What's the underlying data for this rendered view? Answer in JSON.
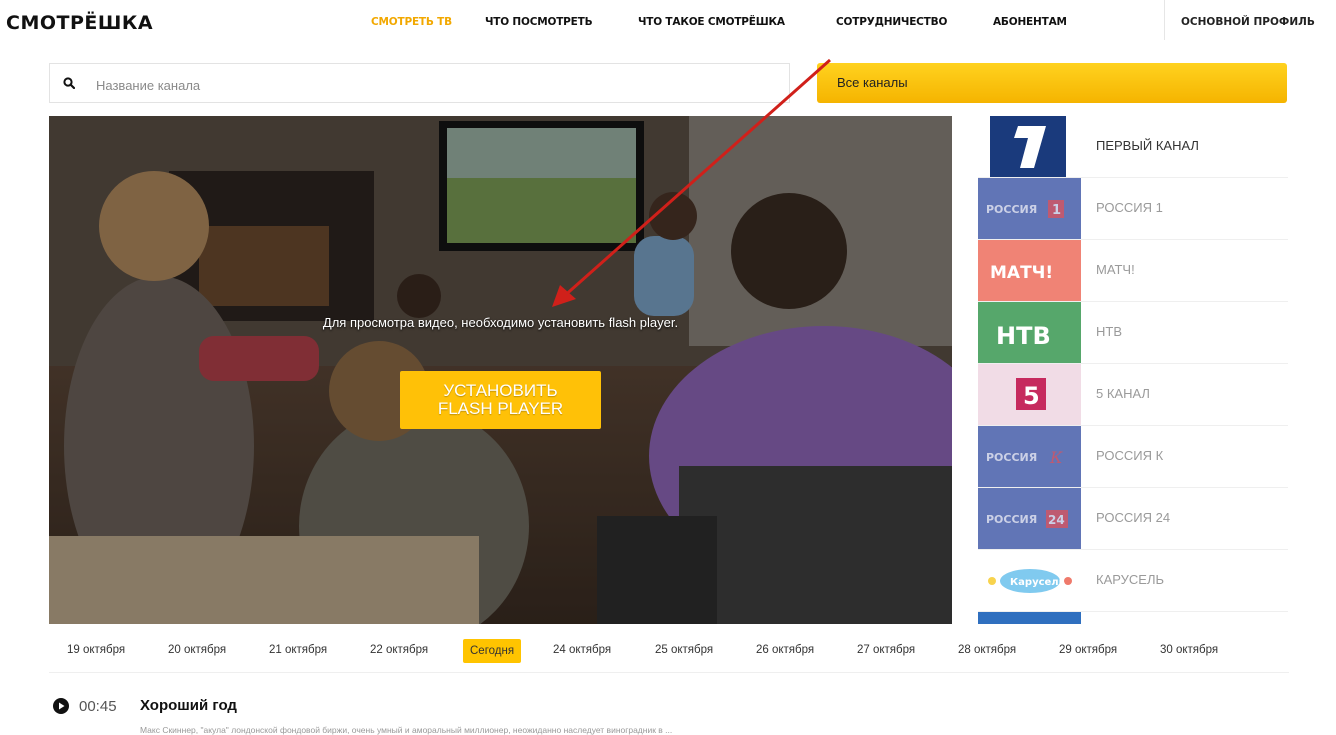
{
  "header": {
    "logo": "СМОТРЁШКА",
    "nav": [
      "СМОТРЕТЬ ТВ",
      "ЧТО ПОСМОТРЕТЬ",
      "ЧТО ТАКОЕ СМОТРЁШКА",
      "СОТРУДНИЧЕСТВО",
      "АБОНЕНТАМ"
    ],
    "profile": "ОСНОВНОЙ ПРОФИЛЬ"
  },
  "search": {
    "placeholder": "Название канала",
    "value": "",
    "icon": "search-icon"
  },
  "all_channels": "Все каналы",
  "player": {
    "message": "Для просмотра видео, необходимо установить flash player.",
    "button_line1": "УСТАНОВИТЬ",
    "button_line2": "FLASH PLAYER"
  },
  "channels": [
    {
      "name": "ПЕРВЫЙ КАНАЛ",
      "logo_text": "1"
    },
    {
      "name": "РОССИЯ 1",
      "logo_text": "РОССИЯ 1"
    },
    {
      "name": "МАТЧ!",
      "logo_text": "МАТЧ!"
    },
    {
      "name": "НТВ",
      "logo_text": "НТВ"
    },
    {
      "name": "5 КАНАЛ",
      "logo_text": "5"
    },
    {
      "name": "РОССИЯ К",
      "logo_text": "РОССИЯ К"
    },
    {
      "name": "РОССИЯ 24",
      "logo_text": "РОССИЯ 24"
    },
    {
      "name": "КАРУСЕЛЬ",
      "logo_text": "Карусель"
    }
  ],
  "dates": [
    "19 октября",
    "20 октября",
    "21 октября",
    "22 октября",
    "Сегодня",
    "24 октября",
    "25 октября",
    "26 октября",
    "27 октября",
    "28 октября",
    "29 октября",
    "30 октября"
  ],
  "program": {
    "time": "00:45",
    "title": "Хороший год",
    "description": "Макс Скиннер, \"акула\" лондонской фондовой биржи, очень умный и аморальный миллионер, неожиданно наследует виноградник в ..."
  },
  "colors": {
    "accent": "#ffc107",
    "nav_active": "#f2a800"
  }
}
